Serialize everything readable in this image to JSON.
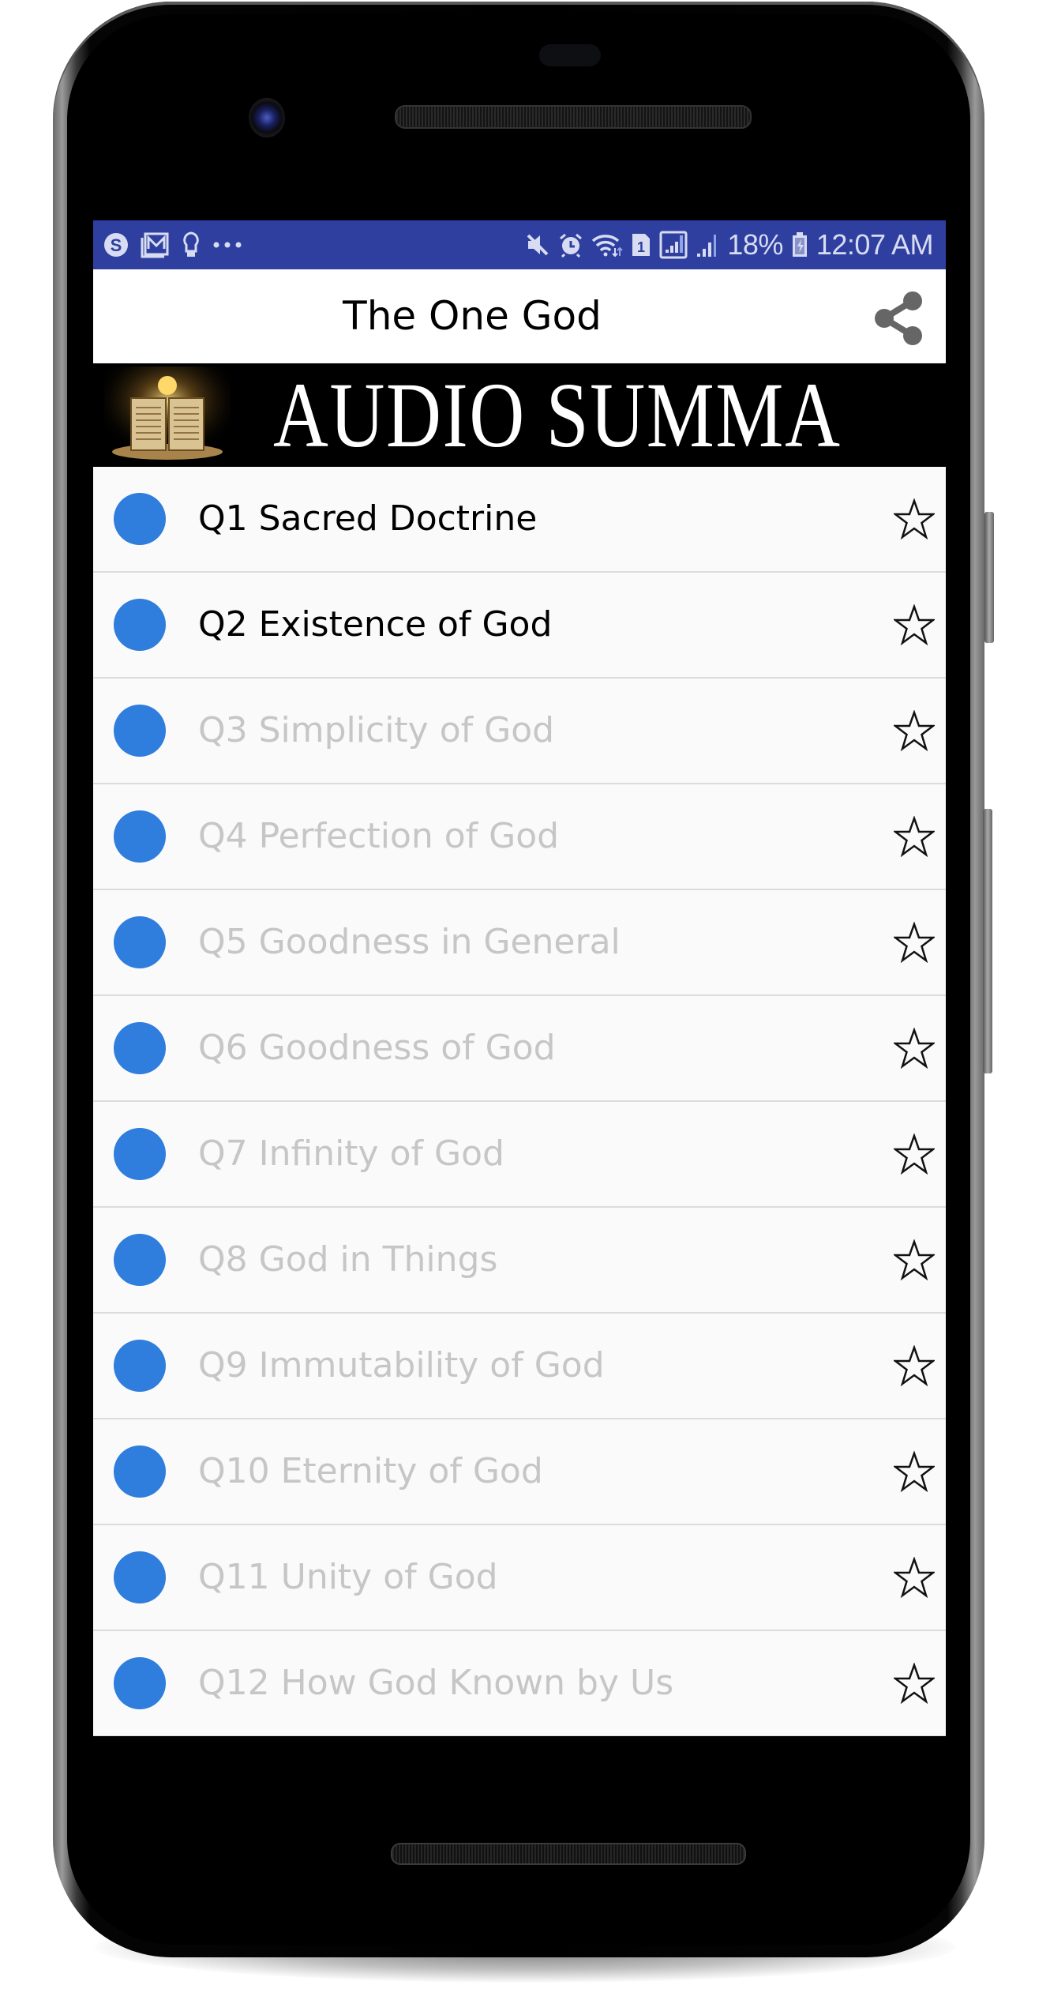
{
  "colors": {
    "status_bar": "#2f3f9f",
    "accent_dot": "#2f7ddc",
    "active_text": "#000000",
    "dim_text": "#c6c6c6",
    "share_icon": "#666666"
  },
  "status_bar": {
    "left_icons": [
      "skype-icon",
      "mail-icon",
      "lightbulb-icon",
      "more-dots-icon"
    ],
    "right_icons": [
      "mute-icon",
      "alarm-icon",
      "wifi-icon",
      "sim-1-icon",
      "signal-box-icon",
      "signal-icon",
      "battery-charging-icon"
    ],
    "battery": "18%",
    "time": "12:07 AM"
  },
  "app_bar": {
    "title": "The One God",
    "share_icon": "share-icon"
  },
  "banner": {
    "text": "AUDIO SUMMA",
    "image": "open-book-illustration"
  },
  "list": {
    "items": [
      {
        "label": "Q1 Sacred Doctrine",
        "state": "active",
        "icon": "circle-icon",
        "favorite": false
      },
      {
        "label": "Q2 Existence of God",
        "state": "active",
        "icon": "circle-icon",
        "favorite": false
      },
      {
        "label": "Q3 Simplicity of God",
        "state": "dim",
        "icon": "circle-icon",
        "favorite": false
      },
      {
        "label": "Q4 Perfection of God",
        "state": "dim",
        "icon": "circle-icon",
        "favorite": false
      },
      {
        "label": "Q5 Goodness in General",
        "state": "dim",
        "icon": "circle-icon",
        "favorite": false
      },
      {
        "label": "Q6 Goodness of God",
        "state": "dim",
        "icon": "circle-icon",
        "favorite": false
      },
      {
        "label": "Q7 Infinity of God",
        "state": "dim",
        "icon": "circle-icon",
        "favorite": false
      },
      {
        "label": "Q8 God in Things",
        "state": "dim",
        "icon": "circle-icon",
        "favorite": false
      },
      {
        "label": "Q9 Immutability of God",
        "state": "dim",
        "icon": "circle-icon",
        "favorite": false
      },
      {
        "label": "Q10 Eternity of God",
        "state": "dim",
        "icon": "circle-icon",
        "favorite": false
      },
      {
        "label": "Q11 Unity of God",
        "state": "dim",
        "icon": "circle-icon",
        "favorite": false
      },
      {
        "label": "Q12 How God Known by Us",
        "state": "dim",
        "icon": "circle-icon",
        "favorite": false
      }
    ]
  }
}
